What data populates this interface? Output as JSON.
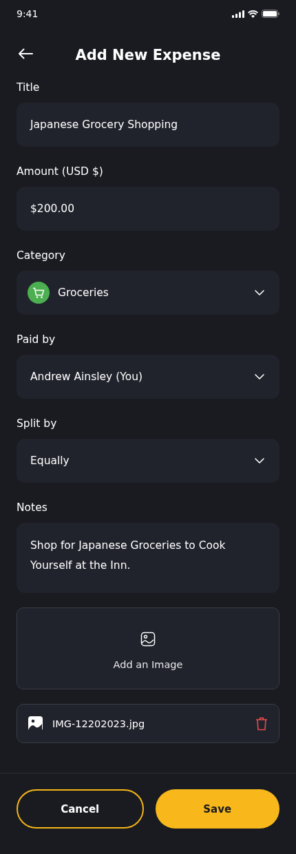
{
  "status_bar": {
    "time": "9:41"
  },
  "header": {
    "title": "Add New Expense"
  },
  "fields": [
    {
      "kind": "text",
      "label": "Title",
      "value": "Japanese Grocery Shopping"
    },
    {
      "kind": "text",
      "label": "Amount (USD $)",
      "value": "$200.00"
    },
    {
      "kind": "category-select",
      "label": "Category",
      "value": "Groceries"
    },
    {
      "kind": "select",
      "label": "Paid by",
      "value": "Andrew Ainsley (You)"
    },
    {
      "kind": "select",
      "label": "Split by",
      "value": "Equally"
    },
    {
      "kind": "textarea",
      "label": "Notes",
      "value": "Shop for Japanese Groceries to Cook Yourself at the Inn."
    }
  ],
  "image_upload": {
    "label": "Add an Image"
  },
  "attachment": {
    "filename": "IMG-12202023.jpg"
  },
  "buttons": [
    {
      "kind": "outline",
      "label": "Cancel"
    },
    {
      "kind": "filled",
      "label": "Save"
    }
  ]
}
